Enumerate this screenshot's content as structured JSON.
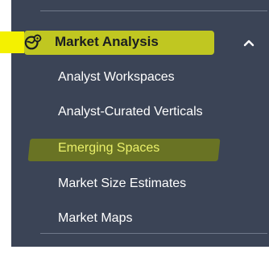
{
  "menu": {
    "section_title": "Market Analysis",
    "section_icon": "globe-gear-icon",
    "toggle_icon": "chevron-up-icon",
    "expanded": true,
    "items": [
      {
        "label": "Analyst Workspaces",
        "active": false
      },
      {
        "label": "Analyst-Curated Verticals",
        "active": false
      },
      {
        "label": "Emerging Spaces",
        "active": true
      },
      {
        "label": "Market Size Estimates",
        "active": false
      },
      {
        "label": "Market Maps",
        "active": false
      }
    ]
  },
  "colors": {
    "sidebar_bg": "#3b4456",
    "divider": "#6f7889",
    "highlight_yellow": "#f4f100",
    "highlight_header": "#c7cf1f",
    "highlight_item": "#6c7622",
    "text_white": "#ffffff",
    "text_dark": "#1a1d21",
    "text_active": "#eaf06a"
  }
}
